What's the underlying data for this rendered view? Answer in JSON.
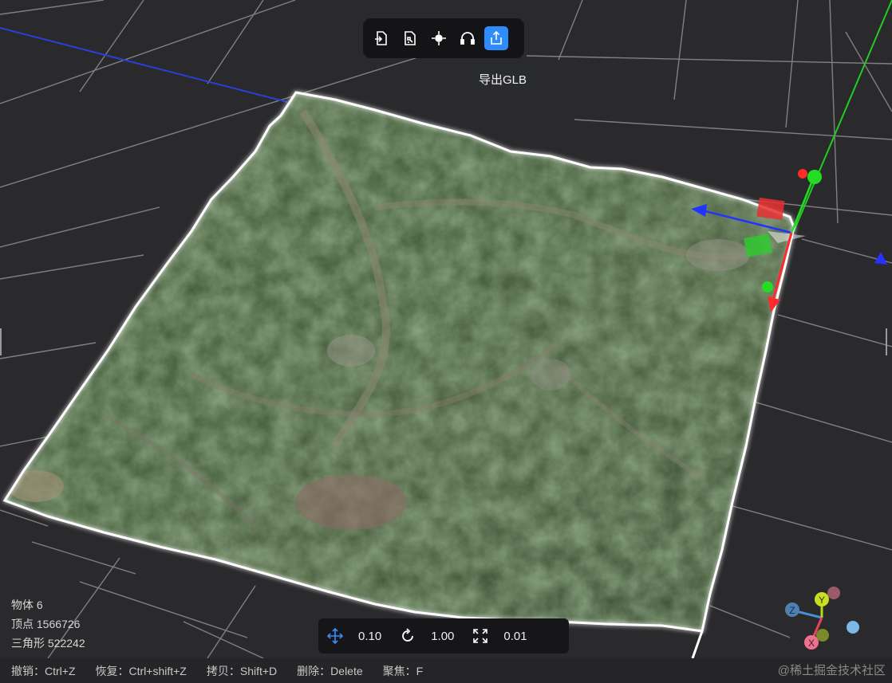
{
  "toolbar": {
    "buttons": [
      {
        "icon": "import-file-icon",
        "active": false
      },
      {
        "icon": "puzzle-file-icon",
        "active": false
      },
      {
        "icon": "crosshair-icon",
        "active": false
      },
      {
        "icon": "headset-icon",
        "active": false
      },
      {
        "icon": "export-icon",
        "active": true
      }
    ]
  },
  "tooltip": {
    "text": "导出GLB"
  },
  "stats": {
    "objects": "物体 6",
    "vertices": "顶点 1566726",
    "triangles": "三角形 522242"
  },
  "transform": {
    "translate_snap": "0.10",
    "rotate_snap": "1.00",
    "scale_snap": "0.01"
  },
  "shortcuts": [
    "撤销：Ctrl+Z",
    "恢复：Ctrl+shift+Z",
    "拷贝：Shift+D",
    "删除：Delete",
    "聚焦：F"
  ],
  "watermark": "@稀土掘金技术社区",
  "gizmo_axes": {
    "x": "X",
    "y": "Y",
    "z": "Z"
  },
  "colors": {
    "accent": "#2f8cff",
    "axis_x": "#ff2a2a",
    "axis_y": "#22dd22",
    "axis_z": "#2233ff"
  }
}
